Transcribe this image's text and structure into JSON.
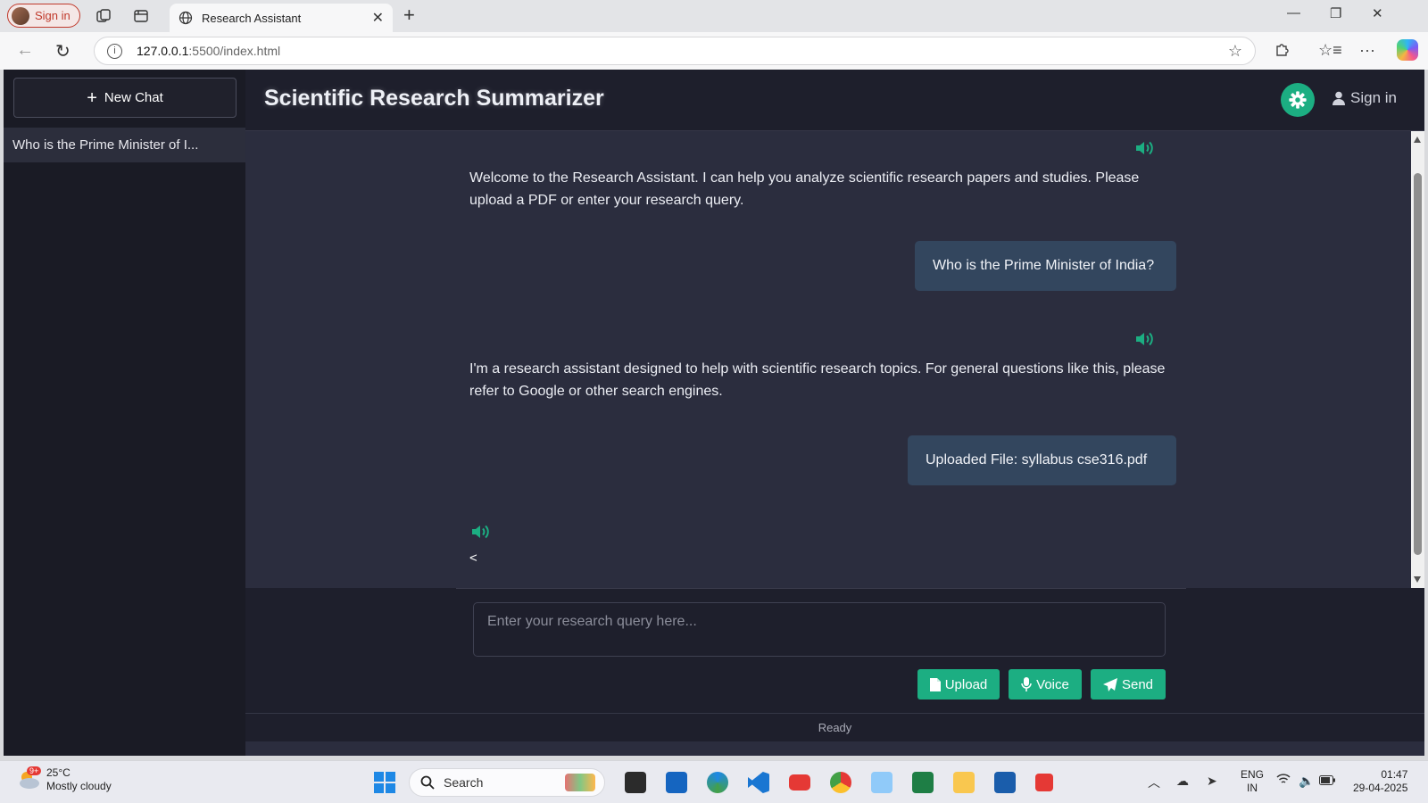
{
  "browser": {
    "profile_label": "Sign in",
    "tab_title": "Research Assistant",
    "url_host": "127.0.0.1",
    "url_path": ":5500/index.html"
  },
  "sidebar": {
    "new_chat_label": "New Chat",
    "history": [
      "Who is the Prime Minister of I..."
    ]
  },
  "header": {
    "title": "Scientific Research Summarizer",
    "signin_label": "Sign in"
  },
  "chat": {
    "messages": [
      {
        "role": "assistant",
        "text": "Welcome to the Research Assistant. I can help you analyze scientific research papers and studies. Please upload a PDF or enter your research query."
      },
      {
        "role": "user",
        "text": "Who is the Prime Minister of India?"
      },
      {
        "role": "assistant",
        "text": "I'm a research assistant designed to help with scientific research topics. For general questions like this, please refer to Google or other search engines."
      },
      {
        "role": "user",
        "text": "Uploaded File: syllabus cse316.pdf"
      },
      {
        "role": "assistant",
        "text": "<"
      }
    ]
  },
  "composer": {
    "placeholder": "Enter your research query here...",
    "upload_label": "Upload",
    "voice_label": "Voice",
    "send_label": "Send"
  },
  "status": "Ready",
  "taskbar": {
    "weather_temp": "25°C",
    "weather_desc": "Mostly cloudy",
    "weather_badge": "9+",
    "search_label": "Search",
    "lang_line1": "ENG",
    "lang_line2": "IN",
    "time": "01:47",
    "date": "29-04-2025"
  },
  "colors": {
    "accent": "#1cae82",
    "user_bubble": "#33465e",
    "chat_bg": "#2b2d3e",
    "sidebar_bg": "#1a1b25"
  },
  "icons": [
    "speaker-icon",
    "gear-icon",
    "user-icon",
    "plus-icon",
    "file-icon",
    "microphone-icon",
    "paper-plane-icon"
  ]
}
